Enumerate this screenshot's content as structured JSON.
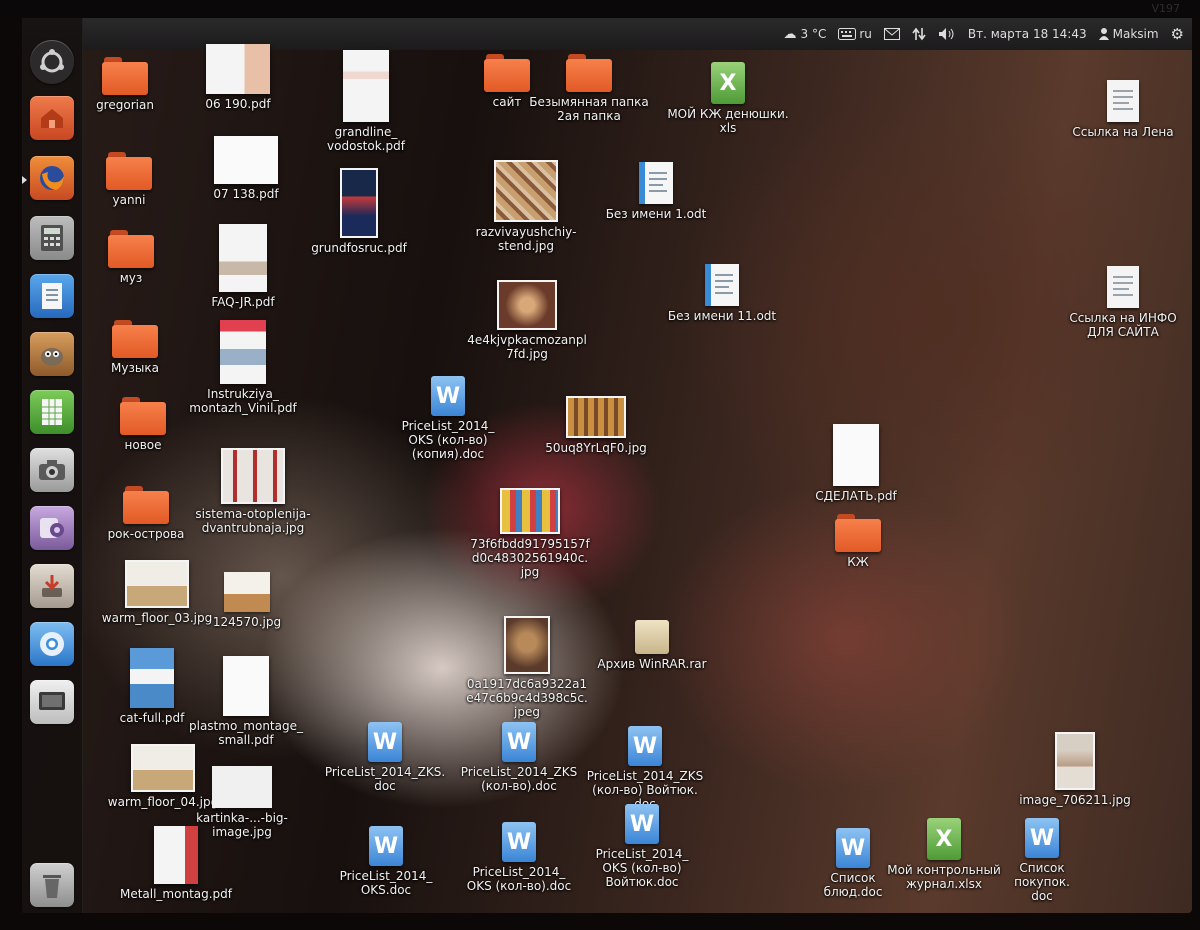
{
  "brand": "V197",
  "panel": {
    "weather": "3 °C",
    "keyboard_layout": "ru",
    "datetime": "Вт. марта 18 14:43",
    "user": "Maksim"
  },
  "launcher": {
    "items": [
      {
        "name": "dash-icon",
        "color": "#3a3a3a"
      },
      {
        "name": "home-folder-icon",
        "color": "#e0613a"
      },
      {
        "name": "firefox-icon",
        "color": "#e05a2a"
      },
      {
        "name": "calculator-icon",
        "color": "#8a8a8a"
      },
      {
        "name": "writer-icon",
        "color": "#3a7fd0"
      },
      {
        "name": "gimp-icon",
        "color": "#a36a35"
      },
      {
        "name": "calc-spreadsheet-icon",
        "color": "#4fa63c"
      },
      {
        "name": "camera-icon",
        "color": "#c8c8c8"
      },
      {
        "name": "webcam-icon",
        "color": "#9a7ab8"
      },
      {
        "name": "installer-icon",
        "color": "#b9b3ad"
      },
      {
        "name": "chromium-icon",
        "color": "#3b8fd8"
      },
      {
        "name": "screen-icon",
        "color": "#d8d8d8"
      },
      {
        "name": "trash-icon",
        "color": "#bdbdbd"
      }
    ]
  },
  "desktop": {
    "folders": [
      {
        "label": "gregorian"
      },
      {
        "label": "yanni"
      },
      {
        "label": "муз"
      },
      {
        "label": "Музыка"
      },
      {
        "label": "новое"
      },
      {
        "label": "рок-острова"
      },
      {
        "label": "сайт"
      },
      {
        "label": "Безымянная папка\n2ая папка"
      },
      {
        "label": "КЖ"
      }
    ],
    "files": [
      {
        "label": "06 190.pdf"
      },
      {
        "label": "07 138.pdf"
      },
      {
        "label": "FAQ-JR.pdf"
      },
      {
        "label": "Instrukziya_\nmontazh_Vinil.pdf"
      },
      {
        "label": "sistema-otoplenija-\ndvantrubnaja.jpg"
      },
      {
        "label": "warm_floor_03.jpg"
      },
      {
        "label": "124570.jpg"
      },
      {
        "label": "cat-full.pdf"
      },
      {
        "label": "plastmo_montage_\nsmall.pdf"
      },
      {
        "label": "warm_floor_04.jpg"
      },
      {
        "label": "kartinka-...-big-\nimage.jpg"
      },
      {
        "label": "Metall_montag.pdf"
      },
      {
        "label": "grandline_\nvodostok.pdf"
      },
      {
        "label": "grundfosruc.pdf"
      },
      {
        "label": "PriceList_2014_\nOKS (кол-во)\n(копия).doc"
      },
      {
        "label": "PriceList_2014_ZKS.\ndoc"
      },
      {
        "label": "PriceList_2014_\nOKS.doc"
      },
      {
        "label": "razvivayushchiy-\nstend.jpg"
      },
      {
        "label": "4e4kjvpkacmozanpl\n7fd.jpg"
      },
      {
        "label": "50uq8YrLqF0.jpg"
      },
      {
        "label": "73f6fbdd91795157f\nd0c48302561940c.\njpg"
      },
      {
        "label": "0a1917dc6a9322a1\ne47c6b9c4d398c5c.\njpeg"
      },
      {
        "label": "PriceList_2014_ZKS\n(кол-во).doc"
      },
      {
        "label": "PriceList_2014_\nOKS (кол-во).doc"
      },
      {
        "label": "МОЙ КЖ денюшки.\nxls"
      },
      {
        "label": "Без имени 1.odt"
      },
      {
        "label": "Без имени 11.odt"
      },
      {
        "label": "Архив WinRAR.rar"
      },
      {
        "label": "PriceList_2014_ZKS\n(кол-во) Войтюк.\ndoc"
      },
      {
        "label": "PriceList_2014_\nOKS (кол-во)\nВойтюк.doc"
      },
      {
        "label": "СДЕЛАТЬ.pdf"
      },
      {
        "label": "Список блюд.doc"
      },
      {
        "label": "Мой контрольный\nжурнал.xlsx"
      },
      {
        "label": "Список покупок.\ndoc"
      },
      {
        "label": "Ссылка на Лена"
      },
      {
        "label": "Ссылка на ИНФО\nДЛЯ САЙТА"
      },
      {
        "label": "image_706211.jpg"
      }
    ]
  }
}
